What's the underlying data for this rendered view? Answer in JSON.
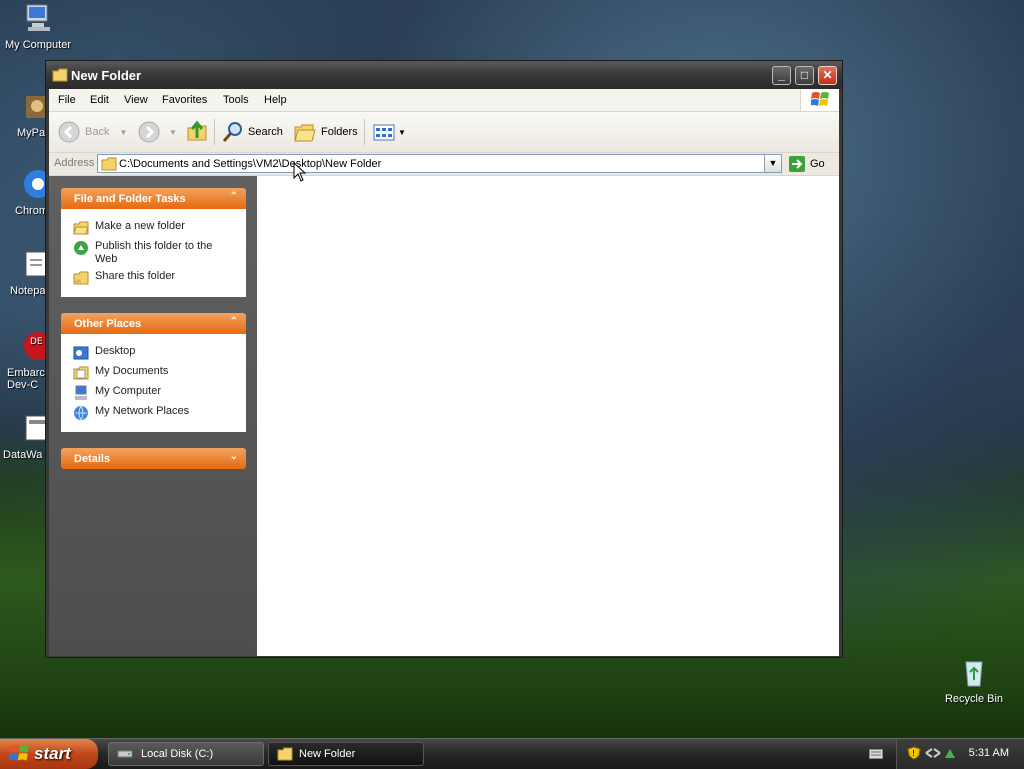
{
  "desktop": {
    "icons": [
      {
        "label": "My Computer"
      },
      {
        "label": "MyPa"
      },
      {
        "label": "Chrom"
      },
      {
        "label": "Notepa"
      },
      {
        "label": "Embarca Dev-C"
      },
      {
        "label": "DataWa"
      },
      {
        "label": "Recycle Bin"
      }
    ]
  },
  "window": {
    "title": "New Folder",
    "menu": [
      "File",
      "Edit",
      "View",
      "Favorites",
      "Tools",
      "Help"
    ],
    "toolbar": {
      "back": "Back",
      "search": "Search",
      "folders": "Folders"
    },
    "address": {
      "label": "Address",
      "value": "C:\\Documents and Settings\\VM2\\Desktop\\New Folder",
      "go": "Go"
    },
    "panels": {
      "file_tasks": {
        "title": "File and Folder Tasks",
        "items": [
          "Make a new folder",
          "Publish this folder to the Web",
          "Share this folder"
        ]
      },
      "other_places": {
        "title": "Other Places",
        "items": [
          "Desktop",
          "My Documents",
          "My Computer",
          "My Network Places"
        ]
      },
      "details": {
        "title": "Details"
      }
    }
  },
  "taskbar": {
    "start": "start",
    "buttons": [
      "Local Disk (C:)",
      "New Folder"
    ],
    "clock": "5:31 AM"
  },
  "colors": {
    "panel_header": "#e56a10",
    "task_pane": "#5a5a5a",
    "link_text": "#222222"
  }
}
